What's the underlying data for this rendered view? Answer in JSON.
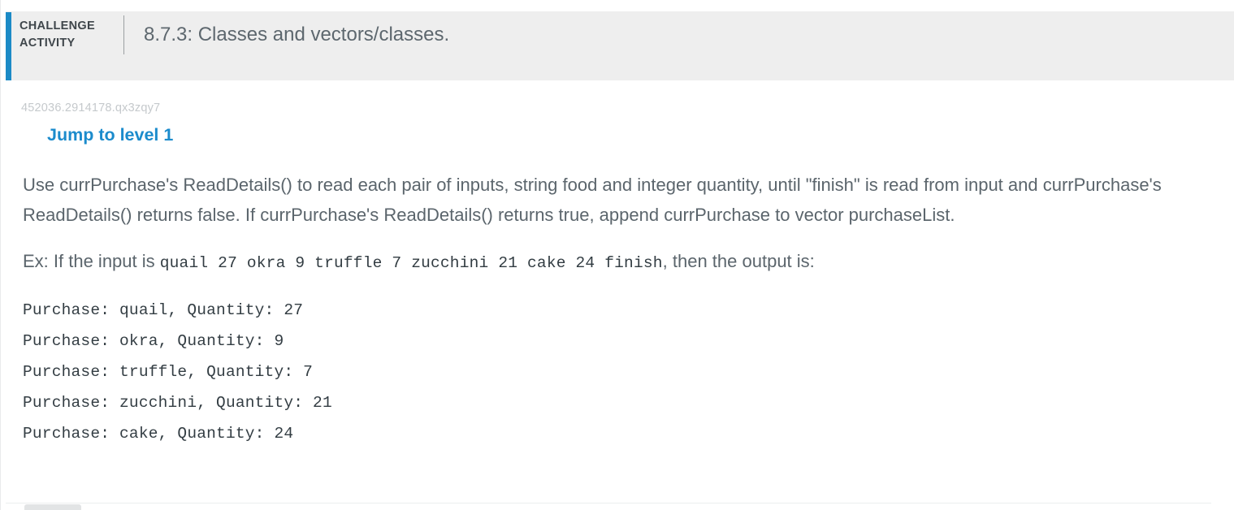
{
  "header": {
    "challenge_label_line1": "CHALLENGE",
    "challenge_label_line2": "ACTIVITY",
    "title": "8.7.3: Classes and vectors/classes.",
    "accent_color": "#1b8ac6",
    "background_color": "#eeeeee"
  },
  "body": {
    "activity_id": "452036.2914178.qx3zqy7",
    "jump_to_level_label": "Jump to level 1",
    "jump_to_level_color": "#1b8bcc",
    "instructions": "Use currPurchase's ReadDetails() to read each pair of inputs, string food and integer quantity, until \"finish\" is read from input and currPurchase's ReadDetails() returns false. If currPurchase's ReadDetails() returns true, append currPurchase to vector purchaseList.",
    "example_prefix": "Ex: If the input is ",
    "example_input": "quail 27 okra 9 truffle 7 zucchini 21 cake 24 finish",
    "example_suffix": ", then the output is:",
    "expected_output": "Purchase: quail, Quantity: 27\nPurchase: okra, Quantity: 9\nPurchase: truffle, Quantity: 7\nPurchase: zucchini, Quantity: 21\nPurchase: cake, Quantity: 24",
    "expected_output_lines": [
      "Purchase: quail, Quantity: 27",
      "Purchase: okra, Quantity: 9",
      "Purchase: truffle, Quantity: 7",
      "Purchase: zucchini, Quantity: 21",
      "Purchase: cake, Quantity: 24"
    ]
  }
}
